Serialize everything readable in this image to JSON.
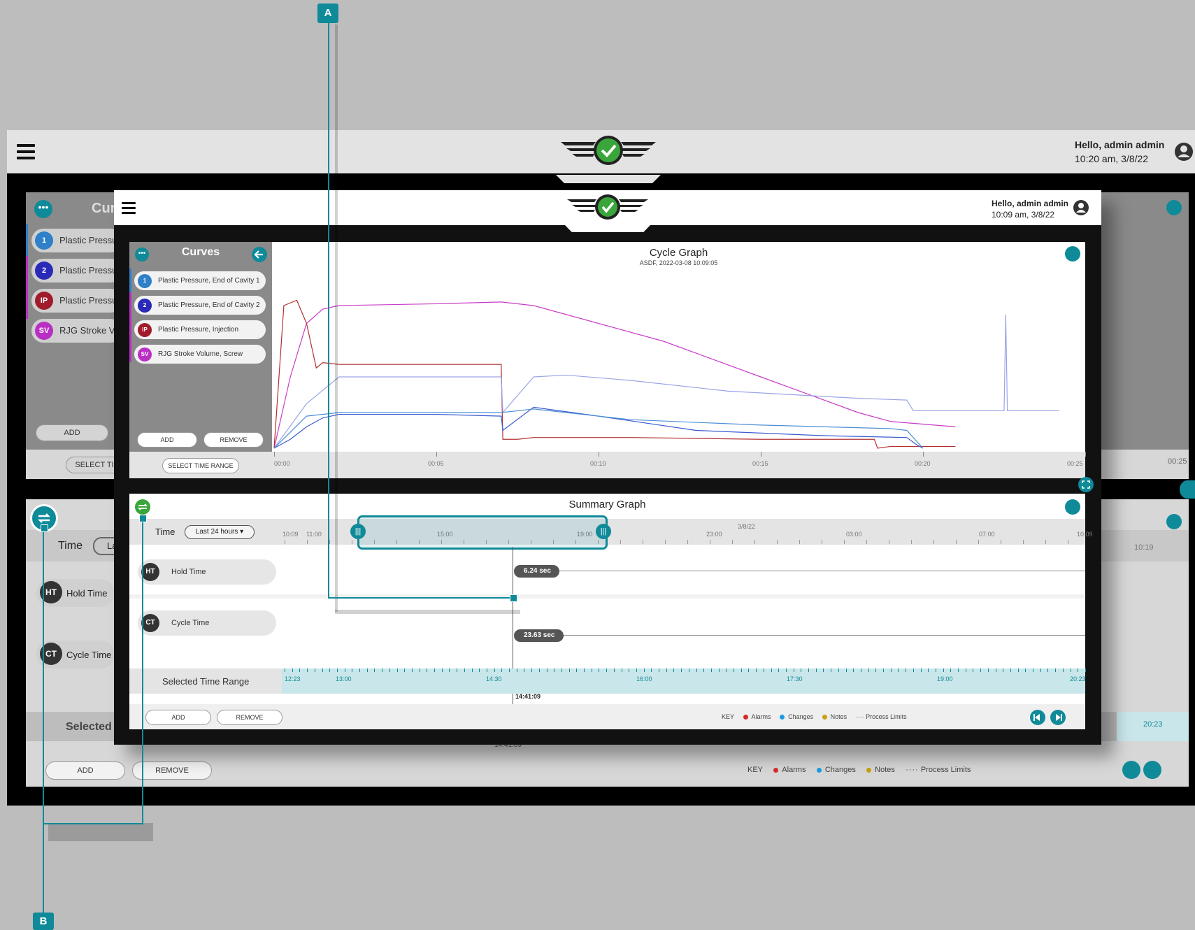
{
  "callouts": {
    "a": "A",
    "b": "B"
  },
  "background_app": {
    "greeting": "Hello, admin admin",
    "datetime": "10:20 am, 3/8/22",
    "curves_title_partial": "Cur",
    "curves": [
      {
        "badge": "1",
        "label": "Plastic Pressu",
        "color": "#2f7fc9"
      },
      {
        "badge": "2",
        "label": "Plastic Pressu",
        "color": "#2a2ab8"
      },
      {
        "badge": "IP",
        "label": "Plastic Pressu",
        "color": "#a01c2c"
      },
      {
        "badge": "SV",
        "label": "RJG Stroke Vo",
        "color": "#b92fc4"
      }
    ],
    "add_label": "ADD",
    "select_time_partial": "SELECT TI",
    "time_label": "Time",
    "time_select_partial": "La",
    "metrics": [
      {
        "badge": "HT",
        "label": "Hold Time"
      },
      {
        "badge": "CT",
        "label": "Cycle Time"
      }
    ],
    "selected_partial": "Selected T",
    "cycle_tick_end": "00:25",
    "summary_tick_end": "10:19",
    "range_tick_end": "20:23",
    "timestamp": "14:41:09",
    "footer": {
      "add": "ADD",
      "remove": "REMOVE",
      "key": "KEY",
      "alarms": "Alarms",
      "changes": "Changes",
      "notes": "Notes",
      "limits": "Process Limits"
    }
  },
  "foreground_app": {
    "greeting": "Hello, admin admin",
    "datetime": "10:09 am, 3/8/22",
    "curves_panel": {
      "title": "Curves",
      "items": [
        {
          "badge": "1",
          "label": "Plastic Pressure, End of Cavity 1",
          "color": "#2f7fc9"
        },
        {
          "badge": "2",
          "label": "Plastic Pressure, End of Cavity 2",
          "color": "#2a2ab8"
        },
        {
          "badge": "IP",
          "label": "Plastic Pressure, Injection",
          "color": "#a01c2c"
        },
        {
          "badge": "SV",
          "label": "RJG Stroke Volume, Screw",
          "color": "#b92fc4"
        }
      ],
      "add": "ADD",
      "remove": "REMOVE",
      "select_time_range": "SELECT TIME RANGE"
    },
    "cycle_graph": {
      "title": "Cycle Graph",
      "subtitle": "ASDF, 2022-03-08   10:09:05",
      "x_ticks": [
        "00:00",
        "00:05",
        "00:10",
        "00:15",
        "00:20",
        "00:25"
      ]
    },
    "summary_graph": {
      "title": "Summary Graph",
      "time_label": "Time",
      "time_select": "Last 24 hours",
      "time_ticks": [
        "10:09",
        "11:00",
        "15:00",
        "19:00",
        "23:00",
        "3/8/22",
        "03:00",
        "07:00",
        "10:09"
      ],
      "metrics": [
        {
          "badge": "HT",
          "label": "Hold Time",
          "value": "6.24 sec"
        },
        {
          "badge": "CT",
          "label": "Cycle Time",
          "value": "23.63 sec"
        }
      ],
      "selected_range_label": "Selected Time Range",
      "range_ticks": [
        "12:23",
        "13:00",
        "14:30",
        "16:00",
        "17:30",
        "19:00",
        "20:23"
      ],
      "cursor_time": "14:41:09",
      "footer": {
        "add": "ADD",
        "remove": "REMOVE",
        "key": "KEY",
        "alarms": "Alarms",
        "changes": "Changes",
        "notes": "Notes",
        "limits": "Process Limits"
      },
      "key_colors": {
        "alarms": "#d42a2a",
        "changes": "#1e9be0",
        "notes": "#c9a010"
      }
    }
  },
  "chart_data": {
    "type": "line",
    "title": "Cycle Graph",
    "subtitle": "ASDF, 2022-03-08   10:09:05",
    "xlabel": "",
    "ylabel": "",
    "x_ticks": [
      "00:00",
      "00:05",
      "00:10",
      "00:15",
      "00:20",
      "00:25"
    ],
    "xlim": [
      0,
      25
    ],
    "ylim": [
      0,
      100
    ],
    "series": [
      {
        "color": "#c93cc9",
        "x": [
          0,
          0.5,
          1,
          1.5,
          2,
          5,
          7,
          8,
          12,
          15,
          18,
          19,
          21
        ],
        "y": [
          0,
          40,
          70,
          78,
          80,
          81,
          82,
          80,
          60,
          40,
          20,
          15,
          12
        ]
      },
      {
        "color": "#b23030",
        "x": [
          0,
          0.3,
          0.7,
          1.0,
          1.3,
          1.5,
          2,
          5,
          7,
          7.05,
          7.5,
          8,
          11,
          15,
          18.5,
          18.6,
          19,
          20,
          21
        ],
        "y": [
          0,
          80,
          83,
          70,
          45,
          48,
          47,
          47,
          47,
          5,
          5,
          6,
          6,
          5,
          5,
          0,
          1,
          1,
          1
        ]
      },
      {
        "color": "#9aa4e6",
        "x": [
          0,
          1,
          2,
          5,
          7,
          7.05,
          8,
          9,
          11,
          14,
          18,
          19.5,
          19.7,
          21,
          22.5,
          22.55,
          22.6,
          23,
          23.5,
          24.2
        ],
        "y": [
          0,
          25,
          40,
          40,
          40,
          20,
          40,
          41,
          38,
          32,
          28,
          27,
          21,
          21,
          21,
          75,
          21,
          21,
          21,
          21
        ]
      },
      {
        "color": "#3b5bd0",
        "x": [
          0,
          0.5,
          1,
          1.5,
          2,
          5,
          7,
          7.05,
          8,
          10,
          13,
          17,
          19.5,
          19.8,
          20
        ],
        "y": [
          0,
          5,
          12,
          17,
          19,
          19,
          18,
          10,
          23,
          18,
          10,
          7,
          6,
          2,
          0
        ]
      },
      {
        "color": "#4c8fd6",
        "x": [
          0,
          1,
          2,
          5,
          7,
          8,
          11,
          15,
          19,
          19.5,
          20
        ],
        "y": [
          0,
          18,
          20,
          20,
          20,
          22,
          16,
          13,
          11,
          10,
          0
        ]
      }
    ]
  }
}
